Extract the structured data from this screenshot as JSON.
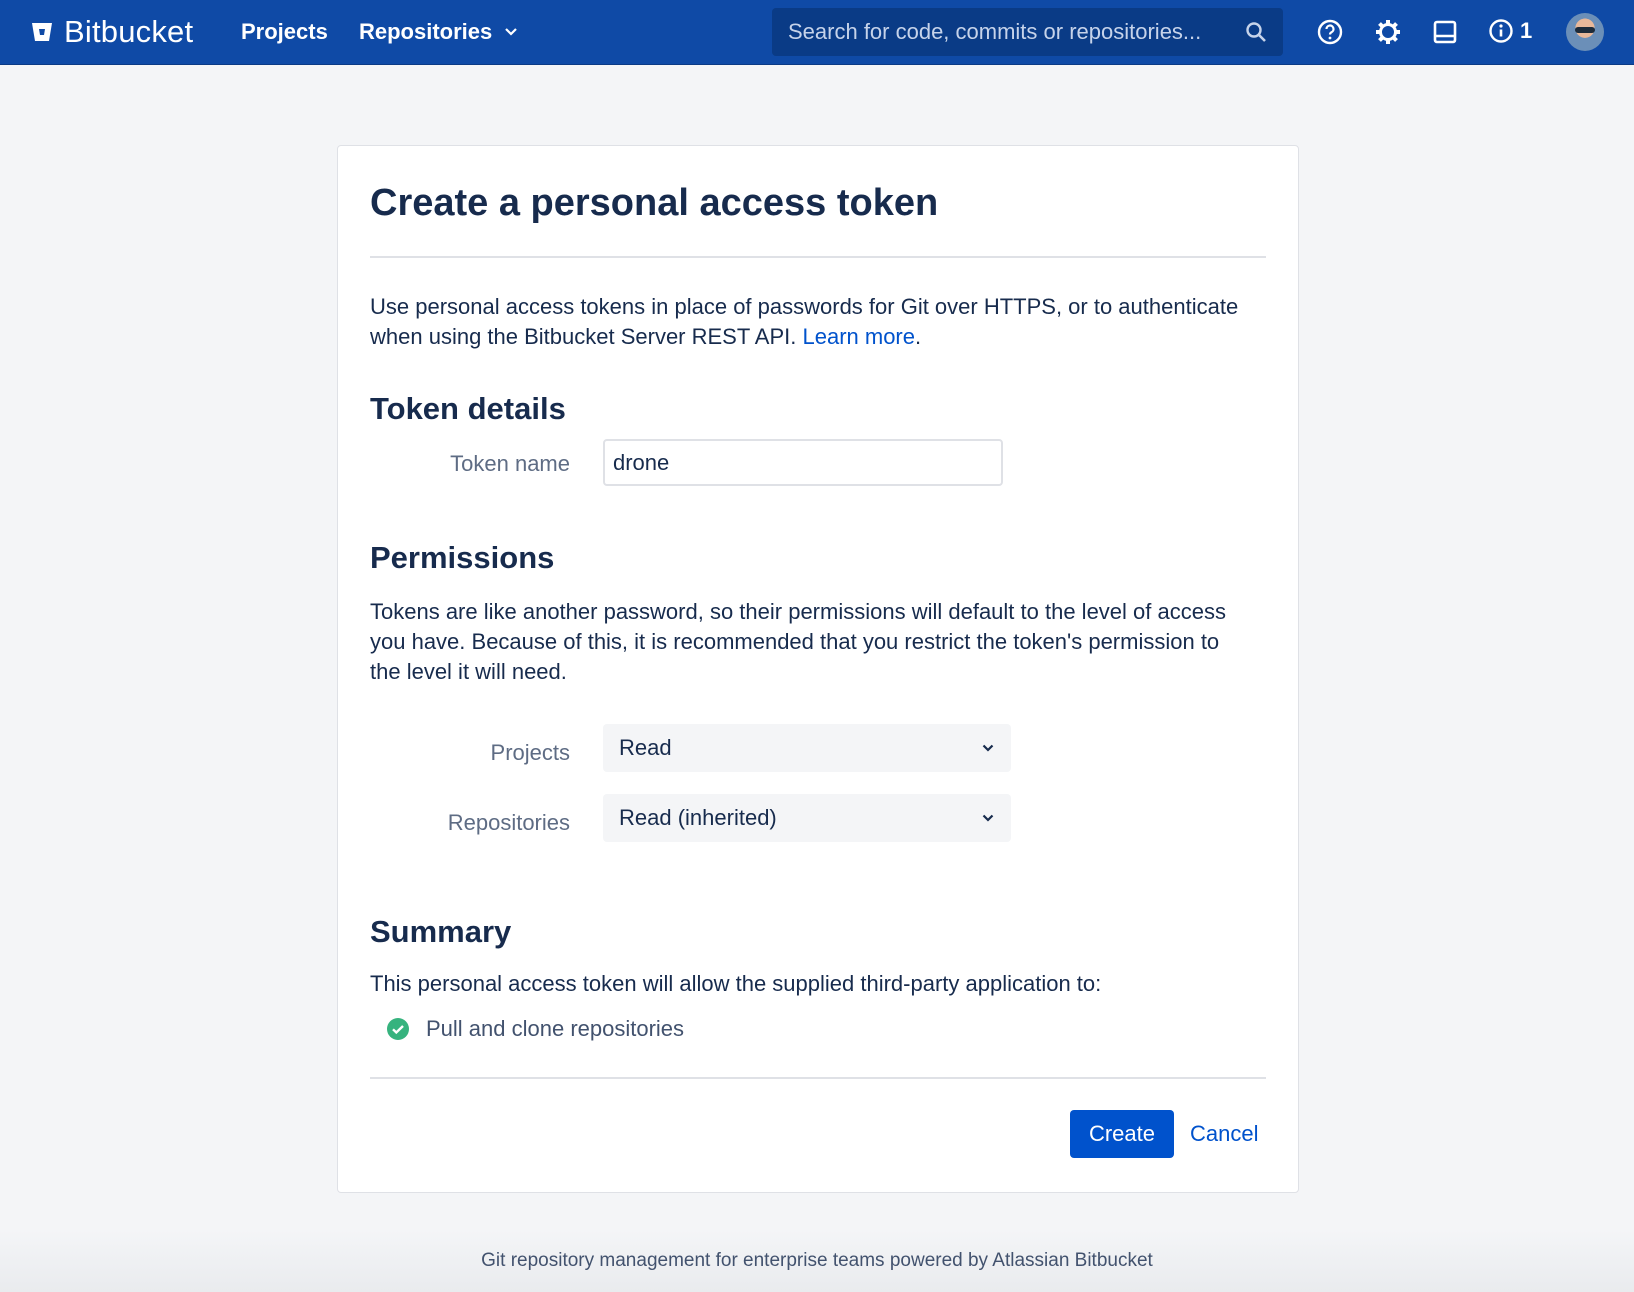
{
  "topbar": {
    "brand": "Bitbucket",
    "nav_projects": "Projects",
    "nav_repositories": "Repositories",
    "search_placeholder": "Search for code, commits or repositories...",
    "notification_count": "1",
    "icons": [
      "bitbucket-logo",
      "chevron-down",
      "search",
      "help",
      "gear",
      "inbox",
      "info",
      "avatar"
    ]
  },
  "page": {
    "title": "Create a personal access token",
    "intro": "Use personal access tokens in place of passwords for Git over HTTPS, or to authenticate when using the Bitbucket Server REST API. ",
    "learn_more": "Learn more",
    "intro_end": "."
  },
  "token_details": {
    "heading": "Token details",
    "name_label": "Token name",
    "name_value": "drone"
  },
  "permissions": {
    "heading": "Permissions",
    "description": "Tokens are like another password, so their permissions will default to the level of access you have. Because of this, it is recommended that you restrict the token's permission to the level it will need.",
    "projects_label": "Projects",
    "projects_value": "Read",
    "repositories_label": "Repositories",
    "repositories_value": "Read (inherited)"
  },
  "summary": {
    "heading": "Summary",
    "text": "This personal access token will allow the supplied third-party application to:",
    "items": [
      "Pull and clone repositories"
    ]
  },
  "actions": {
    "create": "Create",
    "cancel": "Cancel"
  },
  "footer": {
    "text": "Git repository management for enterprise teams powered by Atlassian Bitbucket"
  },
  "colors": {
    "topbar": "#0f4aa6",
    "primary": "#0052cc",
    "success": "#36b37e"
  }
}
